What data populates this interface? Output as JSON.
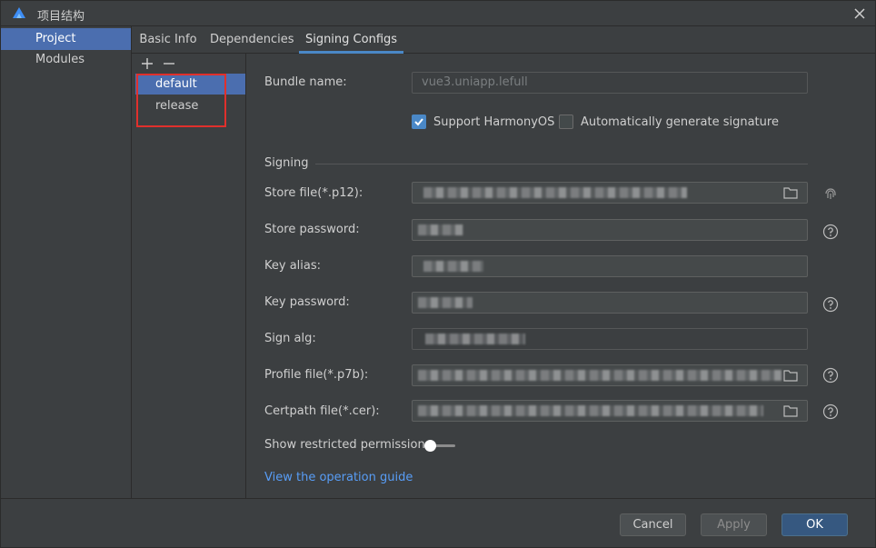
{
  "window": {
    "title": "项目结构",
    "accent_color": "#4b6eaf",
    "highlight_color": "#e0302c"
  },
  "nav": {
    "items": [
      {
        "label": "Project",
        "selected": true
      },
      {
        "label": "Modules",
        "selected": false
      }
    ]
  },
  "tabs": [
    {
      "label": "Basic Info",
      "active": false
    },
    {
      "label": "Dependencies",
      "active": false
    },
    {
      "label": "Signing Configs",
      "active": true
    }
  ],
  "configs": {
    "items": [
      {
        "label": "default",
        "selected": true
      },
      {
        "label": "release",
        "selected": false
      }
    ]
  },
  "form": {
    "bundle_name_label": "Bundle name:",
    "bundle_name_value": "vue3.uniapp.lefull",
    "support_harmonyos_label": "Support HarmonyOS",
    "support_harmonyos_checked": true,
    "auto_sign_label": "Automatically generate signature",
    "auto_sign_checked": false,
    "section_signing": "Signing",
    "store_file_label": "Store file(*.p12):",
    "store_password_label": "Store password:",
    "key_alias_label": "Key alias:",
    "key_password_label": "Key password:",
    "sign_alg_label": "Sign alg:",
    "profile_file_label": "Profile file(*.p7b):",
    "certpath_file_label": "Certpath file(*.cer):",
    "show_restricted_label": "Show restricted permissions",
    "show_restricted_on": false,
    "guide_link": "View the operation guide"
  },
  "footer": {
    "cancel": "Cancel",
    "apply": "Apply",
    "ok": "OK"
  }
}
